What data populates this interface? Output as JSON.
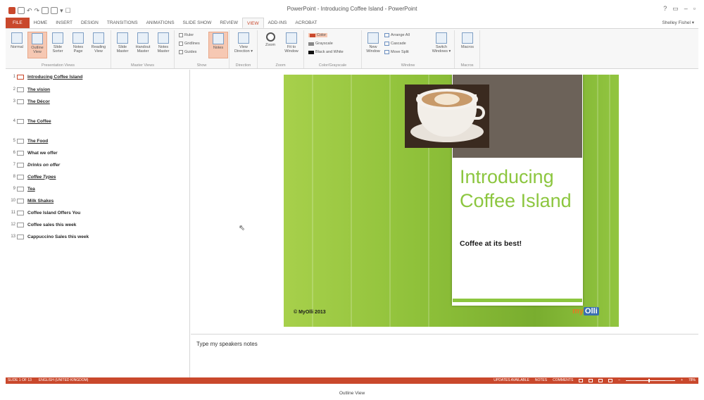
{
  "window": {
    "title": "PowerPoint - Introducing Coffee Island - PowerPoint",
    "controls": [
      "?",
      "▭",
      "–",
      "▫"
    ],
    "account": "Shelley Fishel ▾"
  },
  "quick_access": [
    "▾",
    "☐"
  ],
  "tabs": [
    "FILE",
    "HOME",
    "INSERT",
    "DESIGN",
    "TRANSITIONS",
    "ANIMATIONS",
    "SLIDE SHOW",
    "REVIEW",
    "VIEW",
    "ADD-INS",
    "ACROBAT"
  ],
  "active_tab": "VIEW",
  "ribbon": {
    "presentation_views": {
      "label": "Presentation Views",
      "buttons": [
        "Normal",
        "Outline\nView",
        "Slide\nSorter",
        "Notes\nPage",
        "Reading\nView"
      ]
    },
    "master_views": {
      "label": "Master Views",
      "buttons": [
        "Slide\nMaster",
        "Handout\nMaster",
        "Notes\nMaster"
      ]
    },
    "show": {
      "label": "Show",
      "checks": [
        "Ruler",
        "Gridlines",
        "Guides"
      ],
      "notes_button": "Notes"
    },
    "direction": {
      "label": "Direction",
      "button": "View\nDirection ▾"
    },
    "zoom": {
      "label": "Zoom",
      "buttons": [
        "Zoom",
        "Fit to\nWindow"
      ]
    },
    "color": {
      "label": "Color/Grayscale",
      "items": [
        "Color",
        "Grayscale",
        "Black and White"
      ]
    },
    "window": {
      "label": "Window",
      "new_window": "New\nWindow",
      "items": [
        "Arrange All",
        "Cascade",
        "Move Split"
      ],
      "switch": "Switch\nWindows ▾"
    },
    "macros": {
      "label": "Macros",
      "button": "Macros"
    }
  },
  "outline": [
    {
      "num": "1",
      "text": "Introducing Coffee Island"
    },
    {
      "num": "2",
      "text": "The vision"
    },
    {
      "num": "3",
      "text": "The Décor"
    },
    {
      "num": "4",
      "text": "The Coffee"
    },
    {
      "num": "5",
      "text": "The Food"
    },
    {
      "num": "6",
      "text": "What we offer"
    },
    {
      "num": "7",
      "text": "Drinks on offer"
    },
    {
      "num": "8",
      "text": "Coffee Types"
    },
    {
      "num": "9",
      "text": "Tea"
    },
    {
      "num": "10",
      "text": "Milk Shakes"
    },
    {
      "num": "11",
      "text": "Coffee Island Offers You"
    },
    {
      "num": "12",
      "text": "Coffee sales this week"
    },
    {
      "num": "13",
      "text": "Cappuccino Sales this week"
    }
  ],
  "slide": {
    "title": "Introducing Coffee Island",
    "subtitle": "Coffee at its best!",
    "copyright": "© MyOlli 2013",
    "logo_my": "my",
    "logo_olli": "Olli"
  },
  "notes": {
    "text": "Type my speakers notes"
  },
  "status": {
    "slide": "SLIDE 1 OF 13",
    "language": "ENGLISH (UNITED KINGDOM)",
    "updates": "UPDATES AVAILABLE",
    "notes": "NOTES",
    "comments": "COMMENTS",
    "zoom": "78%"
  },
  "caption": "Outline View",
  "colors": {
    "accent": "#c9482c",
    "slide_green": "#8cc63f",
    "panel_brown": "#6c6259"
  }
}
